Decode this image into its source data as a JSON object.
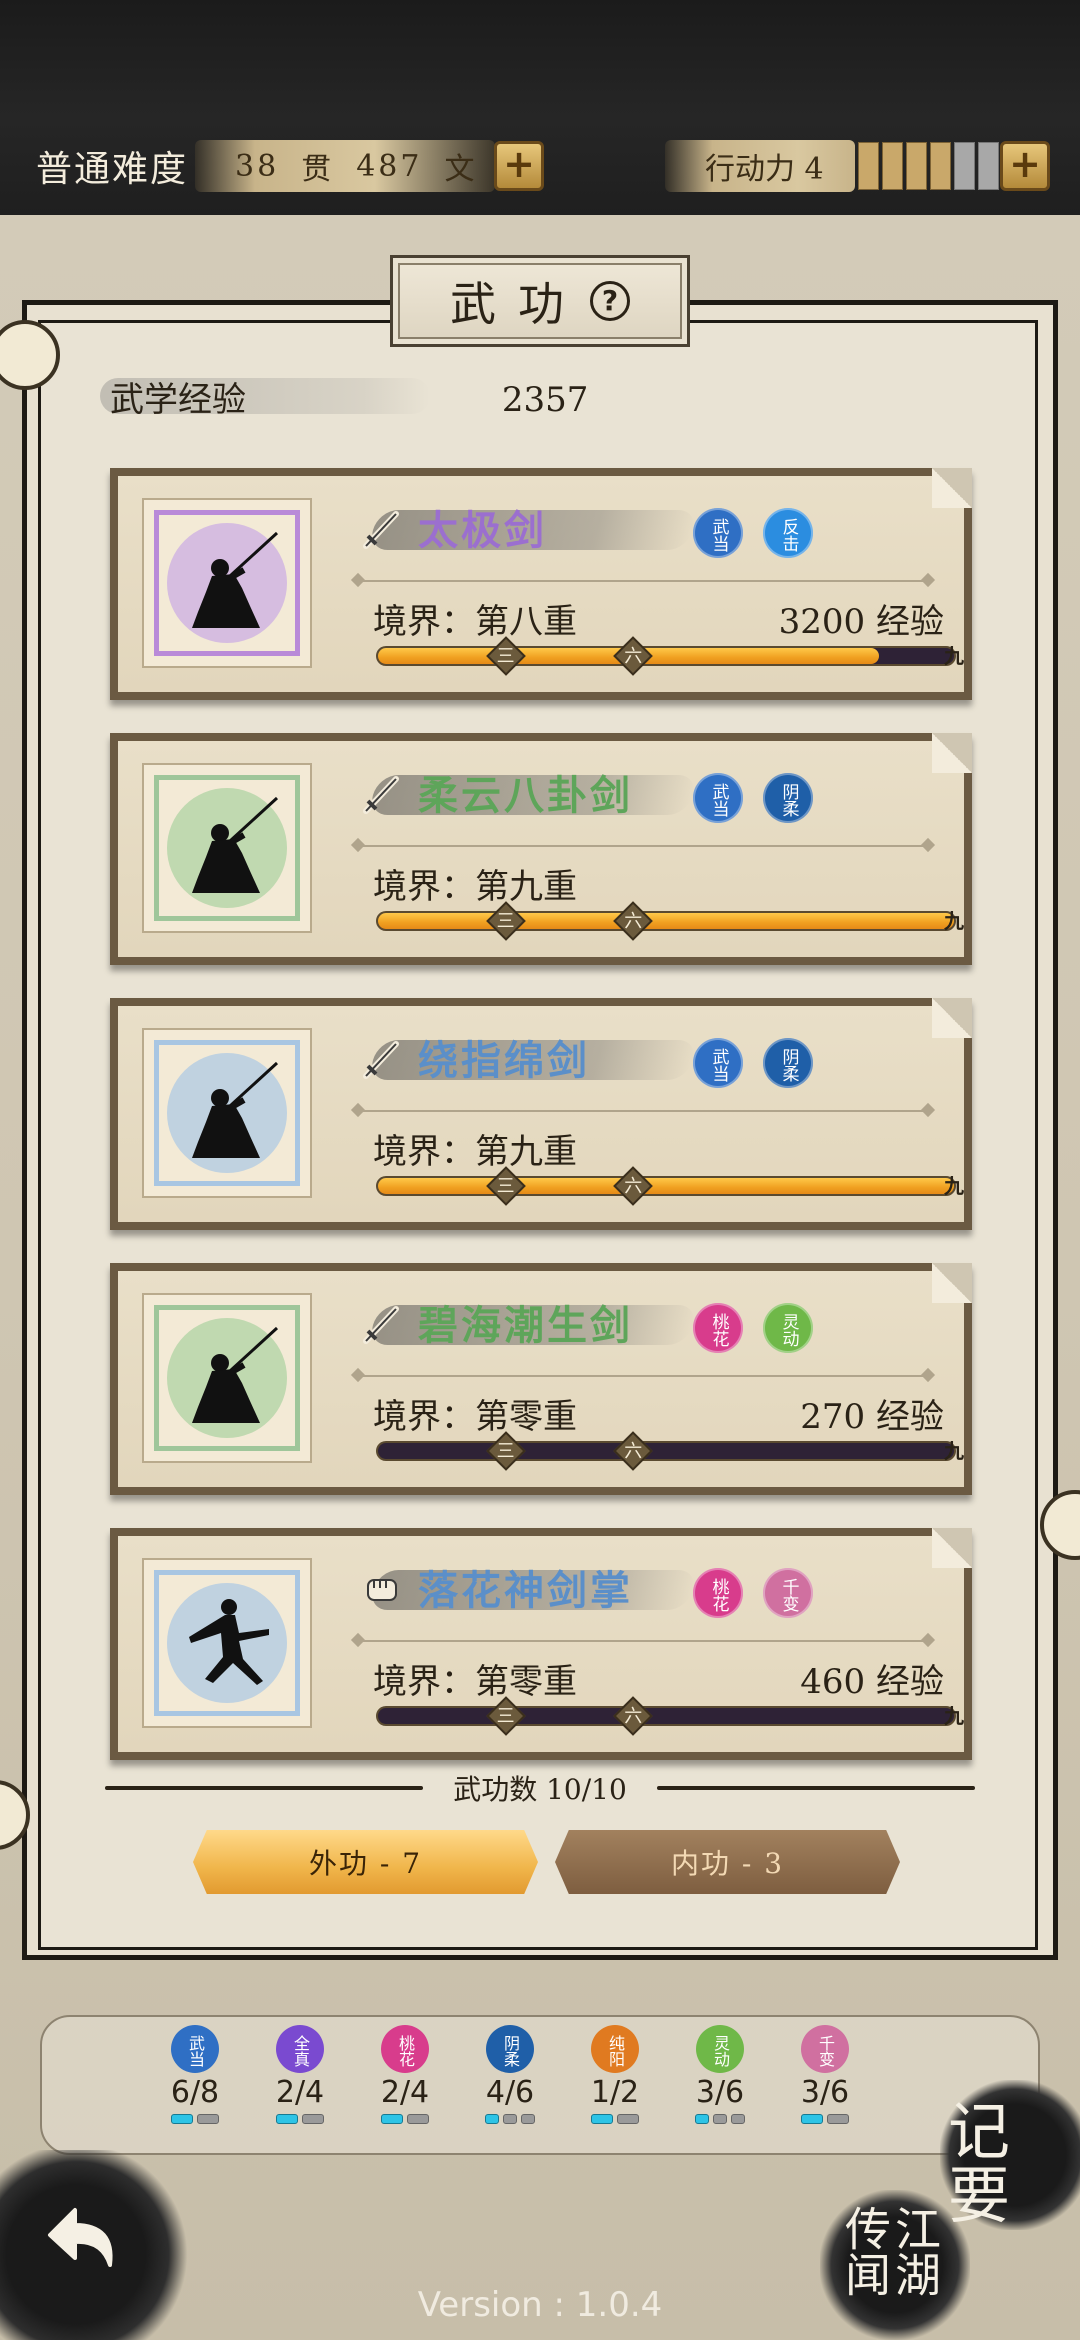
{
  "header": {
    "difficulty": "普通难度",
    "money_guan": "38",
    "money_guan_unit": "贯",
    "money_wen": "487",
    "money_wen_unit": "文",
    "action_label": "行动力 4",
    "action_value": 4,
    "action_max": 6
  },
  "page": {
    "title": "武功",
    "exp_label": "武学经验",
    "exp_value": "2357"
  },
  "skills": [
    {
      "name": "太极剑",
      "name_color": "#9b6fcf",
      "frame_color": "#b98ad8",
      "moon": "#c9a9e4",
      "type": "sword",
      "badges": [
        {
          "text": "武当",
          "color": "#2f6fc4"
        },
        {
          "text": "反击",
          "color": "#2b8de0"
        }
      ],
      "realm": "境界：第八重",
      "exp": "3200 经验",
      "progress": 0.87
    },
    {
      "name": "柔云八卦剑",
      "name_color": "#5ea55a",
      "frame_color": "#9fc69a",
      "moon": "#a9d2a0",
      "type": "sword",
      "badges": [
        {
          "text": "武当",
          "color": "#2f6fc4"
        },
        {
          "text": "阴柔",
          "color": "#1f5fa8"
        }
      ],
      "realm": "境界：第九重",
      "exp": "",
      "progress": 1.0
    },
    {
      "name": "绕指绵剑",
      "name_color": "#5b8fc9",
      "frame_color": "#a8c6e2",
      "moon": "#a9c7e4",
      "type": "sword",
      "badges": [
        {
          "text": "武当",
          "color": "#2f6fc4"
        },
        {
          "text": "阴柔",
          "color": "#1f5fa8"
        }
      ],
      "realm": "境界：第九重",
      "exp": "",
      "progress": 1.0
    },
    {
      "name": "碧海潮生剑",
      "name_color": "#5ea55a",
      "frame_color": "#9fc69a",
      "moon": "#a9d2a0",
      "type": "sword",
      "badges": [
        {
          "text": "桃花",
          "color": "#d83c8c"
        },
        {
          "text": "灵动",
          "color": "#6fb848"
        }
      ],
      "realm": "境界：第零重",
      "exp": "270 经验",
      "progress": 0
    },
    {
      "name": "落花神剑掌",
      "name_color": "#5b8fc9",
      "frame_color": "#a8c6e2",
      "moon": "#a9c7e4",
      "type": "fist",
      "badges": [
        {
          "text": "桃花",
          "color": "#d83c8c"
        },
        {
          "text": "千变",
          "color": "#d070a0"
        }
      ],
      "realm": "境界：第零重",
      "exp": "460 经验",
      "progress": 0
    }
  ],
  "ticks": [
    "三",
    "六",
    "九"
  ],
  "footer": {
    "count_label": "武功数 10/10",
    "tab_outer": "外功 - 7",
    "tab_inner": "内功 - 3"
  },
  "sects": [
    {
      "text": "武当",
      "color": "#2f6fc4",
      "value": "6/8",
      "on": 1,
      "total": 2
    },
    {
      "text": "全真",
      "color": "#7a4ad0",
      "value": "2/4",
      "on": 1,
      "total": 2
    },
    {
      "text": "桃花",
      "color": "#d83c8c",
      "value": "2/4",
      "on": 1,
      "total": 2
    },
    {
      "text": "阴柔",
      "color": "#1f5fa8",
      "value": "4/6",
      "on": 1,
      "total": 3
    },
    {
      "text": "纯阳",
      "color": "#e07a20",
      "value": "1/2",
      "on": 1,
      "total": 2
    },
    {
      "text": "灵动",
      "color": "#6fb848",
      "value": "3/6",
      "on": 1,
      "total": 3
    },
    {
      "text": "千变",
      "color": "#d070a0",
      "value": "3/6",
      "on": 1,
      "total": 2
    }
  ],
  "nav": {
    "jiyao_1": "记",
    "jiyao_2": "要",
    "jianghu": "江湖传闻",
    "version": "Version : 1.0.4"
  },
  "icons": [
    "plus-icon",
    "help-icon",
    "sword-icon",
    "fist-icon",
    "back-arrow-icon"
  ]
}
